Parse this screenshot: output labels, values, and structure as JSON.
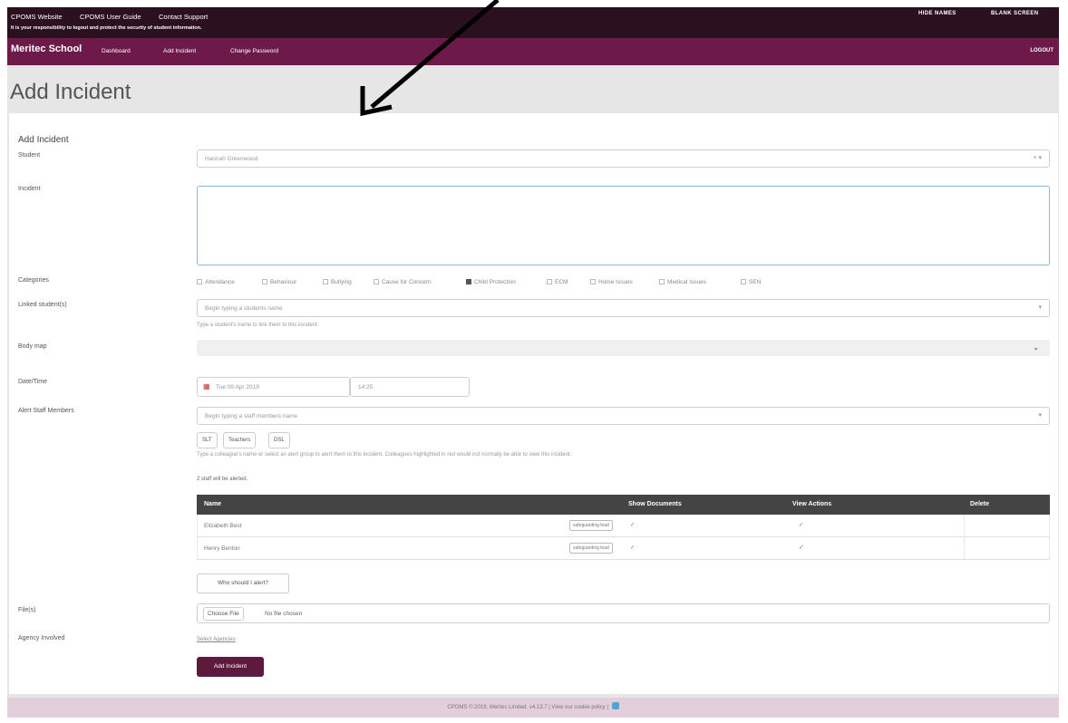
{
  "topbar": {
    "links": [
      "CPOMS Website",
      "CPOMS User Guide",
      "Contact Support"
    ],
    "notice": "It is your responsibility to logout and protect the security of student information.",
    "hide_names": "HIDE NAMES",
    "blank_screen": "BLANK SCREEN"
  },
  "nav": {
    "school": "Meritec School",
    "links": [
      "Dashboard",
      "Add Incident",
      "Change Password"
    ],
    "logout": "LOGOUT"
  },
  "page_title": "Add Incident",
  "form": {
    "heading": "Add Incident",
    "student": {
      "label": "Student",
      "value": "Hannah Greenwood"
    },
    "incident": {
      "label": "Incident",
      "value": ""
    },
    "categories": {
      "label": "Categories",
      "items": [
        {
          "label": "Attendance",
          "checked": false
        },
        {
          "label": "Behaviour",
          "checked": false
        },
        {
          "label": "Bullying",
          "checked": false
        },
        {
          "label": "Cause for Concern",
          "checked": false
        },
        {
          "label": "Child Protection",
          "checked": true
        },
        {
          "label": "ECM",
          "checked": false
        },
        {
          "label": "Home Issues",
          "checked": false
        },
        {
          "label": "Medical Issues",
          "checked": false
        },
        {
          "label": "SEN",
          "checked": false
        }
      ]
    },
    "linked_students": {
      "label": "Linked student(s)",
      "placeholder": "Begin typing a students name",
      "help": "Type a student's name to link them to this incident."
    },
    "body_map": {
      "label": "Body map"
    },
    "datetime": {
      "label": "Date/Time",
      "date": "Tue 09 Apr 2019",
      "time": "14:25"
    },
    "alert_staff": {
      "label": "Alert Staff Members",
      "placeholder": "Begin typing a staff members name",
      "groups": [
        "SLT",
        "Teachers",
        "DSL"
      ],
      "help": "Type a colleague's name or select an alert group to alert them to this incident. Colleagues highlighted in red would not normally be able to view this incident.",
      "count_text": "2 staff will be alerted."
    },
    "staff_table": {
      "headers": [
        "Name",
        "Show Documents",
        "View Actions",
        "Delete"
      ],
      "rows": [
        {
          "name": "Elizabeth Best",
          "tag": "safeguarding lead",
          "show_docs": "✓",
          "view_actions": "✓"
        },
        {
          "name": "Henry Benton",
          "tag": "safeguarding lead",
          "show_docs": "✓",
          "view_actions": "✓"
        }
      ]
    },
    "who_alert_btn": "Who should I alert?",
    "files": {
      "label": "File(s)",
      "button": "Choose File",
      "status": "No file chosen"
    },
    "agency": {
      "label": "Agency Involved",
      "link": "Select Agencies"
    },
    "submit": "Add Incident"
  },
  "footer": "CPOMS © 2019, Meritec Limited. v4.13.7 | View our cookie policy |"
}
